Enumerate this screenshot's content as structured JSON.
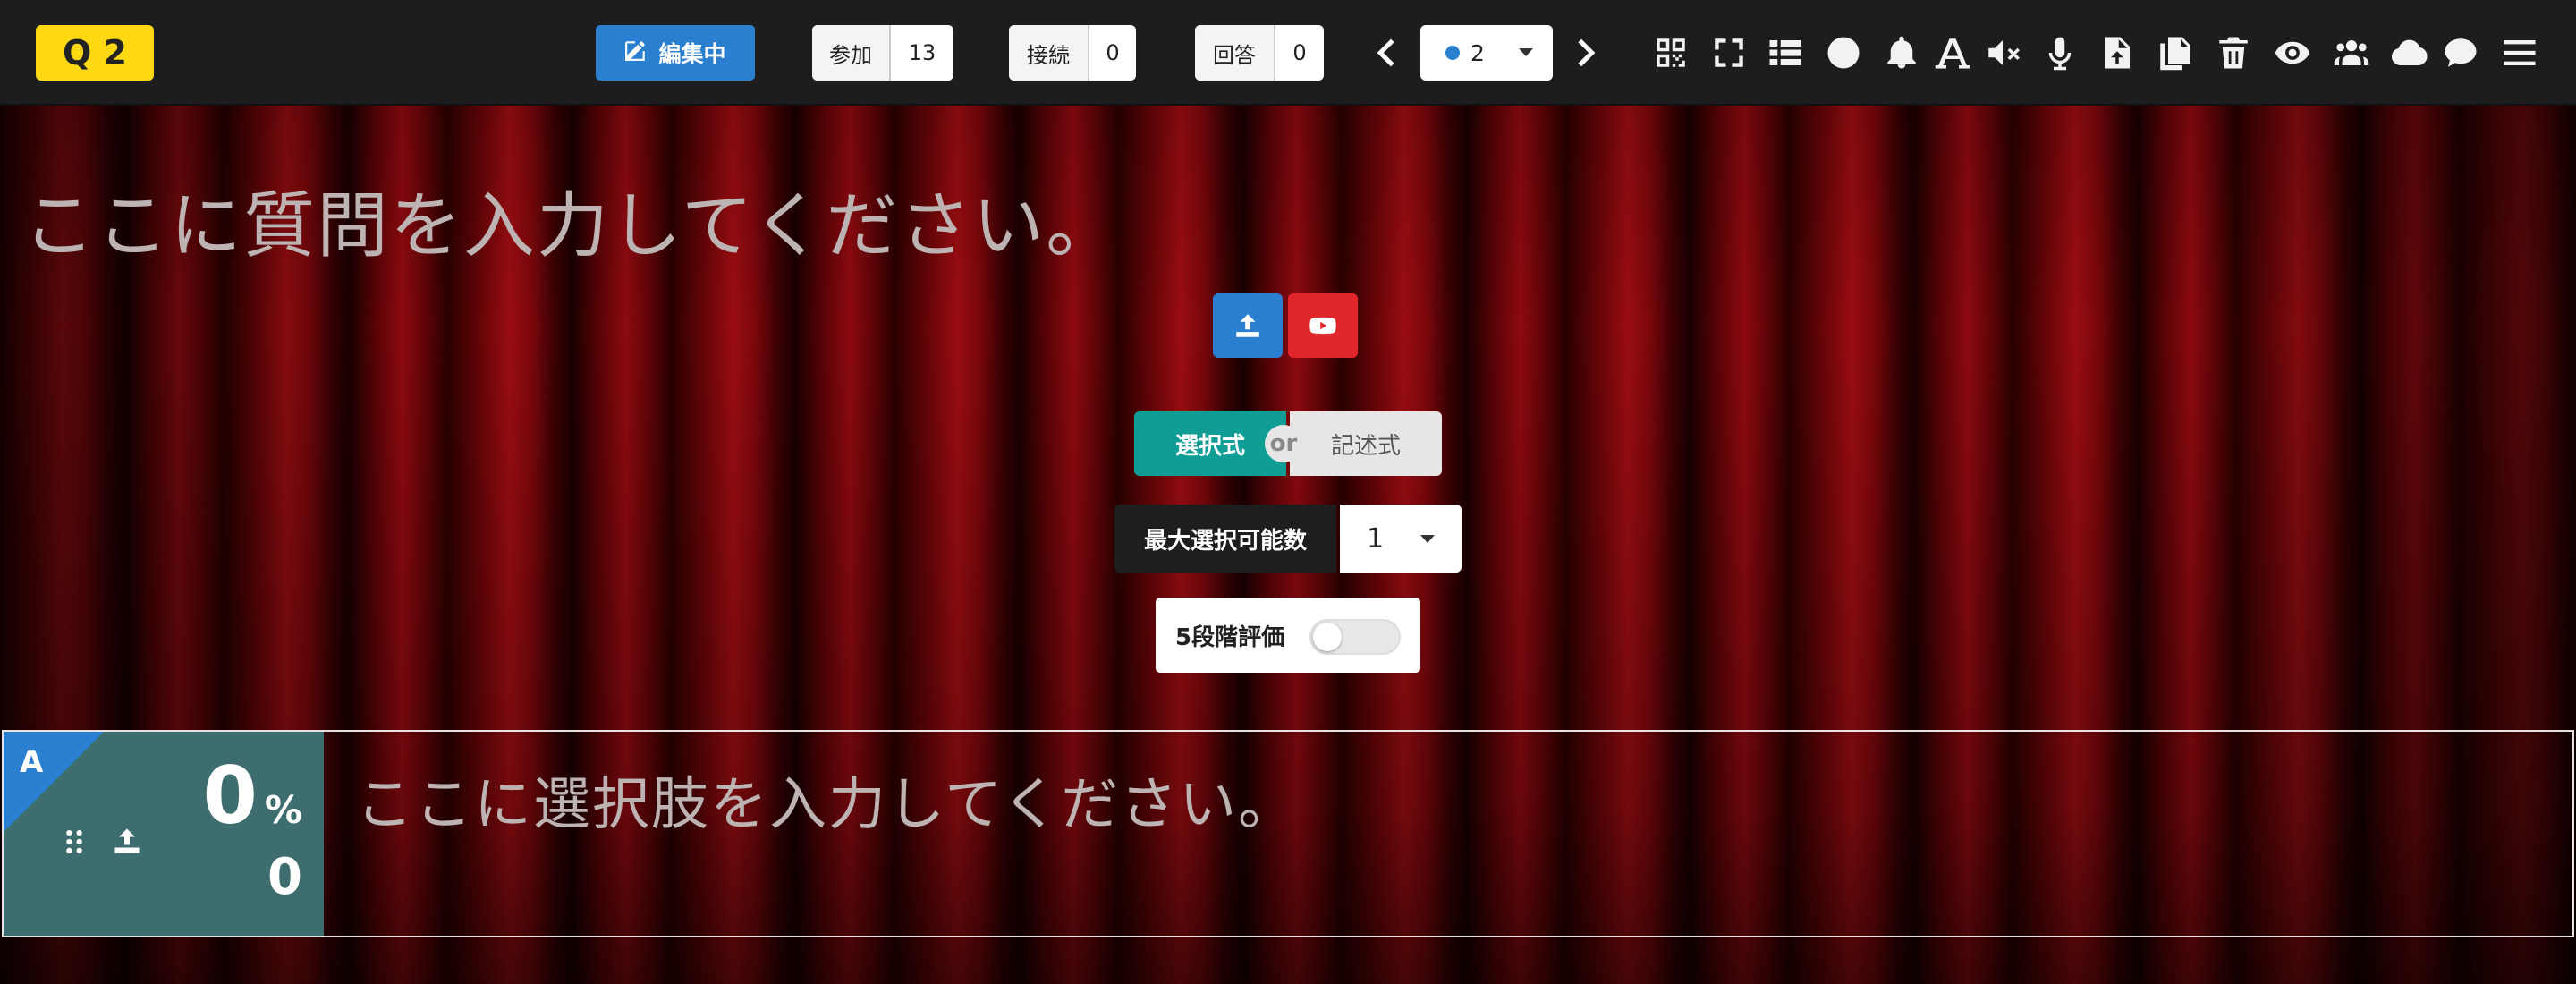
{
  "header": {
    "question_badge": "Q 2",
    "edit_label": "編集中",
    "counters": [
      {
        "label": "参加",
        "value": "13"
      },
      {
        "label": "接続",
        "value": "0"
      },
      {
        "label": "回答",
        "value": "0"
      }
    ],
    "question_selector": {
      "value": "2",
      "dot_color": "#2a7fd1"
    },
    "toolbar_icons": [
      "qrcode-icon",
      "fullscreen-icon",
      "list-icon",
      "clock-icon",
      "bell-icon",
      "font-icon",
      "volume-mute-icon",
      "microphone-icon",
      "file-upload-icon",
      "copy-icon",
      "trash-icon",
      "eye-icon",
      "users-icon",
      "cloud-icon",
      "comment-icon",
      "hamburger-menu-icon"
    ]
  },
  "main": {
    "question_placeholder": "ここに質問を入力してください。",
    "media_buttons": {
      "upload_color": "#2a7fd1",
      "youtube_color": "#e0262b"
    },
    "answer_type": {
      "choice_label": "選択式",
      "or_label": "or",
      "text_label": "記述式"
    },
    "max_selectable": {
      "label": "最大選択可能数",
      "value": "1"
    },
    "five_star_rating": {
      "label": "5段階評価",
      "enabled": false
    }
  },
  "choices": [
    {
      "letter": "A",
      "percent": "0",
      "percent_symbol": "%",
      "count": "0",
      "placeholder": "ここに選択肢を入力してください。"
    }
  ]
}
